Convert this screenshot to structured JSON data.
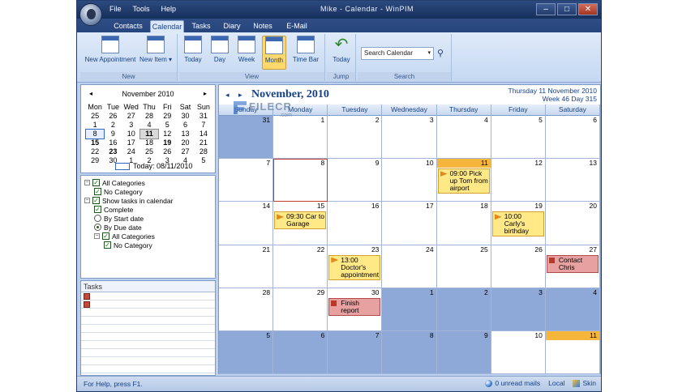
{
  "window": {
    "title": "Mike - Calendar - WinPIM",
    "menu": [
      "File",
      "Tools",
      "Help"
    ],
    "controls": {
      "minimize": "–",
      "maximize": "□",
      "close": "✕"
    }
  },
  "ribbon": {
    "tabs": [
      "Contacts",
      "Calendar",
      "Tasks",
      "Diary",
      "Notes",
      "E-Mail"
    ],
    "active_tab": "Calendar",
    "groups": {
      "new": {
        "label": "New",
        "buttons": [
          "New Appointment",
          "New Item ▾"
        ]
      },
      "view": {
        "label": "View",
        "buttons": [
          "Today",
          "Day",
          "Week",
          "Month",
          "Time Bar"
        ],
        "active": "Month"
      },
      "jump": {
        "label": "Jump",
        "buttons": [
          "Today"
        ]
      },
      "search": {
        "label": "Search",
        "placeholder": "Search Calendar"
      }
    }
  },
  "minicalendar": {
    "title": "November 2010",
    "prev": "◂",
    "next": "▸",
    "weekdays": [
      "Mon",
      "Tue",
      "Wed",
      "Thu",
      "Fri",
      "Sat",
      "Sun"
    ],
    "weeks": [
      [
        "25",
        "26",
        "27",
        "28",
        "29",
        "30",
        "31"
      ],
      [
        "1",
        "2",
        "3",
        "4",
        "5",
        "6",
        "7"
      ],
      [
        "8",
        "9",
        "10",
        "11",
        "12",
        "13",
        "14"
      ],
      [
        "15",
        "16",
        "17",
        "18",
        "19",
        "20",
        "21"
      ],
      [
        "22",
        "23",
        "24",
        "25",
        "26",
        "27",
        "28"
      ],
      [
        "29",
        "30",
        "1",
        "2",
        "3",
        "4",
        "5"
      ]
    ],
    "today_label": "Today: 08/11/2010"
  },
  "filters": [
    {
      "type": "checkbox",
      "expander": "−",
      "label": "All Categories",
      "checked": true,
      "indent": 0
    },
    {
      "type": "checkbox",
      "label": "No Category",
      "checked": true,
      "indent": 1
    },
    {
      "type": "checkbox",
      "expander": "−",
      "label": "Show tasks in calendar",
      "checked": true,
      "indent": 0
    },
    {
      "type": "checkbox",
      "label": "Complete",
      "checked": true,
      "indent": 1
    },
    {
      "type": "radio",
      "label": "By Start date",
      "checked": false,
      "indent": 1
    },
    {
      "type": "radio",
      "label": "By Due date",
      "checked": true,
      "indent": 1
    },
    {
      "type": "checkbox",
      "expander": "−",
      "label": "All Categories",
      "checked": true,
      "indent": 1
    },
    {
      "type": "checkbox",
      "label": "No Category",
      "checked": true,
      "indent": 2
    }
  ],
  "tasks_panel": {
    "title": "Tasks",
    "count_icons": 2
  },
  "calendar": {
    "prev": "◂",
    "next": "▸",
    "title": "November, 2010",
    "date_info_line1": "Thursday  11 November 2010",
    "date_info_line2": "Week 46  Day 315",
    "weekdays": [
      "Sunday",
      "Monday",
      "Tuesday",
      "Wednesday",
      "Thursday",
      "Friday",
      "Saturday"
    ],
    "weeks": [
      [
        "31",
        "1",
        "2",
        "3",
        "4",
        "5",
        "6"
      ],
      [
        "7",
        "8",
        "9",
        "10",
        "11",
        "12",
        "13"
      ],
      [
        "14",
        "15",
        "16",
        "17",
        "18",
        "19",
        "20"
      ],
      [
        "21",
        "22",
        "23",
        "24",
        "25",
        "26",
        "27"
      ],
      [
        "28",
        "29",
        "30",
        "1",
        "2",
        "3",
        "4"
      ],
      [
        "5",
        "6",
        "7",
        "8",
        "9",
        "10",
        "11"
      ]
    ],
    "events": [
      {
        "week": 1,
        "day": 4,
        "text": "09:00 Pick up Tom from airport",
        "style": "yellow"
      },
      {
        "week": 2,
        "day": 1,
        "text": "09:30 Car to Garage",
        "style": "yellow"
      },
      {
        "week": 2,
        "day": 5,
        "text": "10:00 Carly's birthday",
        "style": "yellow"
      },
      {
        "week": 3,
        "day": 2,
        "text": "13:00 Doctor's appointment",
        "style": "yellow"
      },
      {
        "week": 3,
        "day": 6,
        "text": "Contact Chris",
        "style": "red"
      },
      {
        "week": 4,
        "day": 2,
        "text": "Finish report",
        "style": "red"
      }
    ]
  },
  "watermark": {
    "text": "FILECR",
    "sub": ".com"
  },
  "statusbar": {
    "left": "For Help, press F1.",
    "unread": "0 unread mails",
    "mode": "Local",
    "skin": "Skin"
  },
  "colors": {
    "accent": "#15428b",
    "other_month": "#8ea9d8",
    "today_highlight": "#f6b63b",
    "event_yellow": "#ffe886",
    "event_red": "#e7a1a1"
  }
}
